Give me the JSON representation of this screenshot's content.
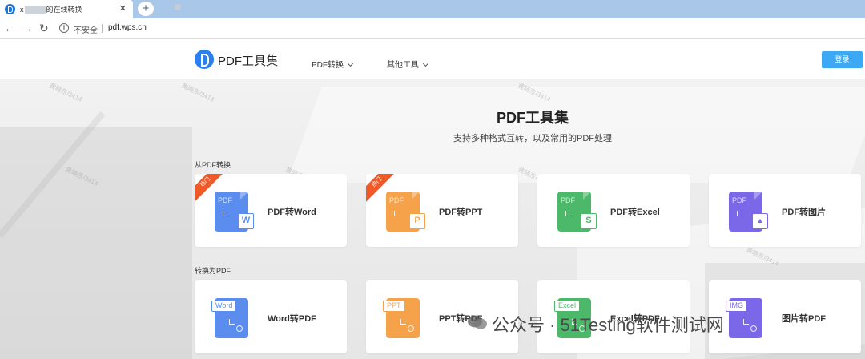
{
  "browser": {
    "tab_title_prefix": "x",
    "tab_title_suffix": "的在线转换",
    "new_tab": "+",
    "insecure_label": "不安全",
    "url": "pdf.wps.cn"
  },
  "header": {
    "logo_text": "PDF工具集",
    "nav": [
      "PDF转换",
      "其他工具"
    ],
    "login_label": "登录"
  },
  "hero": {
    "title": "PDF工具集",
    "subtitle": "支持多种格式互转，以及常用的PDF处理"
  },
  "sections": [
    {
      "label": "从PDF转换",
      "cards": [
        {
          "label": "PDF转Word",
          "hot": "热门",
          "icon": "pdf-to-word-icon",
          "color": "#5b8def",
          "badge": "W"
        },
        {
          "label": "PDF转PPT",
          "hot": "热门",
          "icon": "pdf-to-ppt-icon",
          "color": "#f5a24b",
          "badge": "P"
        },
        {
          "label": "PDF转Excel",
          "hot": "",
          "icon": "pdf-to-excel-icon",
          "color": "#4cb96a",
          "badge": "S"
        },
        {
          "label": "PDF转图片",
          "hot": "",
          "icon": "pdf-to-image-icon",
          "color": "#7b68e8",
          "badge": "▲"
        }
      ]
    },
    {
      "label": "转换为PDF",
      "cards": [
        {
          "label": "Word转PDF",
          "tag": "Word",
          "icon": "word-to-pdf-icon",
          "color": "#5b8def"
        },
        {
          "label": "PPT转PDF",
          "tag": "PPT",
          "icon": "ppt-to-pdf-icon",
          "color": "#f5a24b"
        },
        {
          "label": "Excel转PDF",
          "tag": "Excel",
          "icon": "excel-to-pdf-icon",
          "color": "#4cb96a"
        },
        {
          "label": "图片转PDF",
          "tag": "IMG",
          "icon": "image-to-pdf-icon",
          "color": "#7b68e8"
        }
      ]
    }
  ],
  "doc_text": "PDF",
  "watermark_text": "黄晓东/3414",
  "overlay_text": "公众号 · 51Testing软件测试网"
}
